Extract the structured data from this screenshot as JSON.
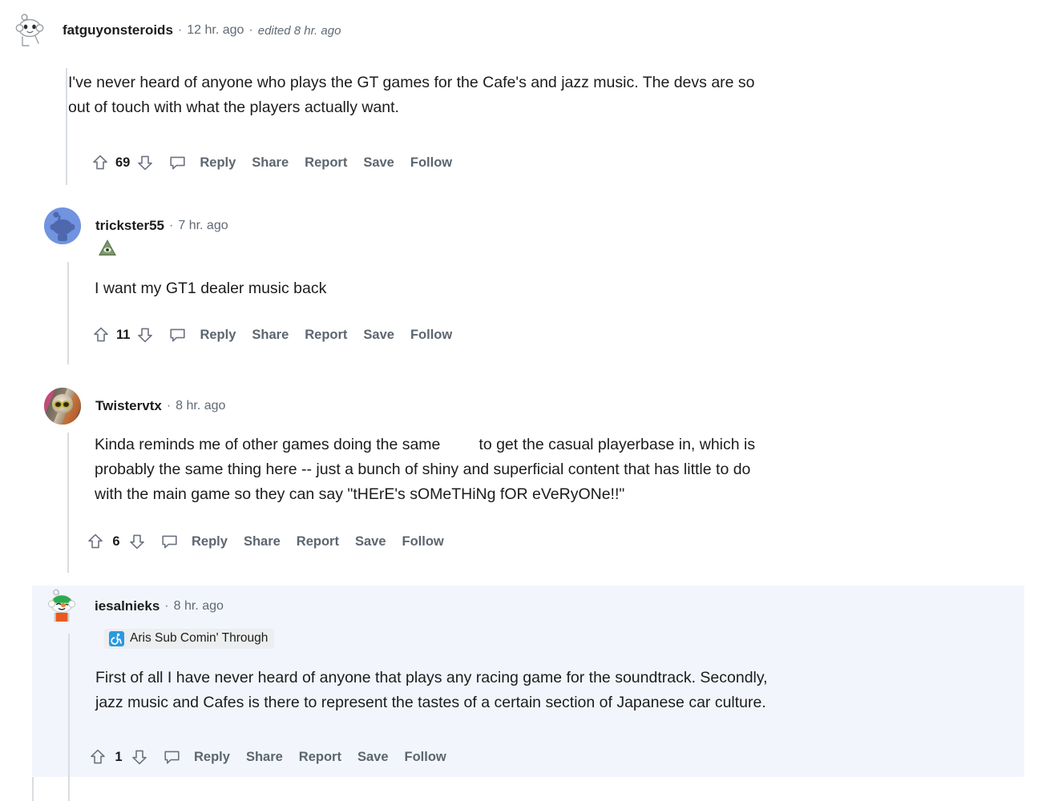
{
  "page": {
    "platform": "reddit",
    "view": "comment-thread"
  },
  "colors": {
    "text": "#1c1c1c",
    "meta": "#606a75",
    "action": "#5c6670",
    "rail": "#d9dde2",
    "highlight_bg": "#f2f6fc",
    "flair_bg": "#eceef0",
    "flair_icon_bg": "#2a9ae0",
    "avatar_blue": "#7193e0"
  },
  "actions_labels": {
    "reply": "Reply",
    "share": "Share",
    "report": "Report",
    "save": "Save",
    "follow": "Follow",
    "upvote_icon": "upvote-arrow-icon",
    "downvote_icon": "downvote-arrow-icon",
    "comment_icon": "comment-bubble-icon"
  },
  "comments": [
    {
      "id": "c1",
      "author": "fatguyonsteroids",
      "separator": "·",
      "time": "12 hr. ago",
      "edited": "edited 8 hr. ago",
      "avatar": "snoo-default",
      "flair": null,
      "emoji_flair": null,
      "body_lines": [
        "I've never heard of anyone who plays the GT games for the Cafe's and jazz music. The devs are so",
        "out of touch with what the players actually want."
      ],
      "score": "69",
      "highlighted": false
    },
    {
      "id": "c2",
      "author": "trickster55",
      "separator": "·",
      "time": "7 hr. ago",
      "edited": null,
      "avatar": "snoo-blue",
      "flair": null,
      "emoji_flair": "pyramid-eye-emoji",
      "body_lines": [
        "I want my GT1 dealer music back"
      ],
      "score": "11",
      "highlighted": false
    },
    {
      "id": "c3",
      "author": "Twistervtx",
      "separator": "·",
      "time": "8 hr. ago",
      "edited": null,
      "avatar": "photo",
      "flair": null,
      "emoji_flair": null,
      "body_lines": [
        "Kinda reminds me of other games doing the same ␣ to get the casual playerbase in, which is",
        "probably the same thing here -- just a bunch of shiny and superficial content that has little to do",
        "with the main game so they can say \"tHErE's sOMeTHiNg fOR eVeRyONe!!\""
      ],
      "body_line1_a": "Kinda reminds me of other games doing the same",
      "body_line1_b": "to get the casual playerbase in, which is",
      "body_line2": "probably the same thing here -- just a bunch of shiny and superficial content that has little to do",
      "body_line3": "with the main game so they can say \"tHErE's sOMeTHiNg fOR eVeRyONe!!\"",
      "score": "6",
      "highlighted": false
    },
    {
      "id": "c4",
      "author": "iesalnieks",
      "separator": "·",
      "time": "8 hr. ago",
      "edited": null,
      "avatar": "snoo-green",
      "flair": {
        "icon": "wheelchair-icon",
        "text": "Aris Sub Comin' Through"
      },
      "emoji_flair": null,
      "body_lines": [
        "First of all I have never heard of anyone that plays any racing game for the soundtrack. Secondly,",
        "jazz music and Cafes is there to represent the tastes of a certain section of Japanese car culture."
      ],
      "score": "1",
      "highlighted": true
    }
  ]
}
